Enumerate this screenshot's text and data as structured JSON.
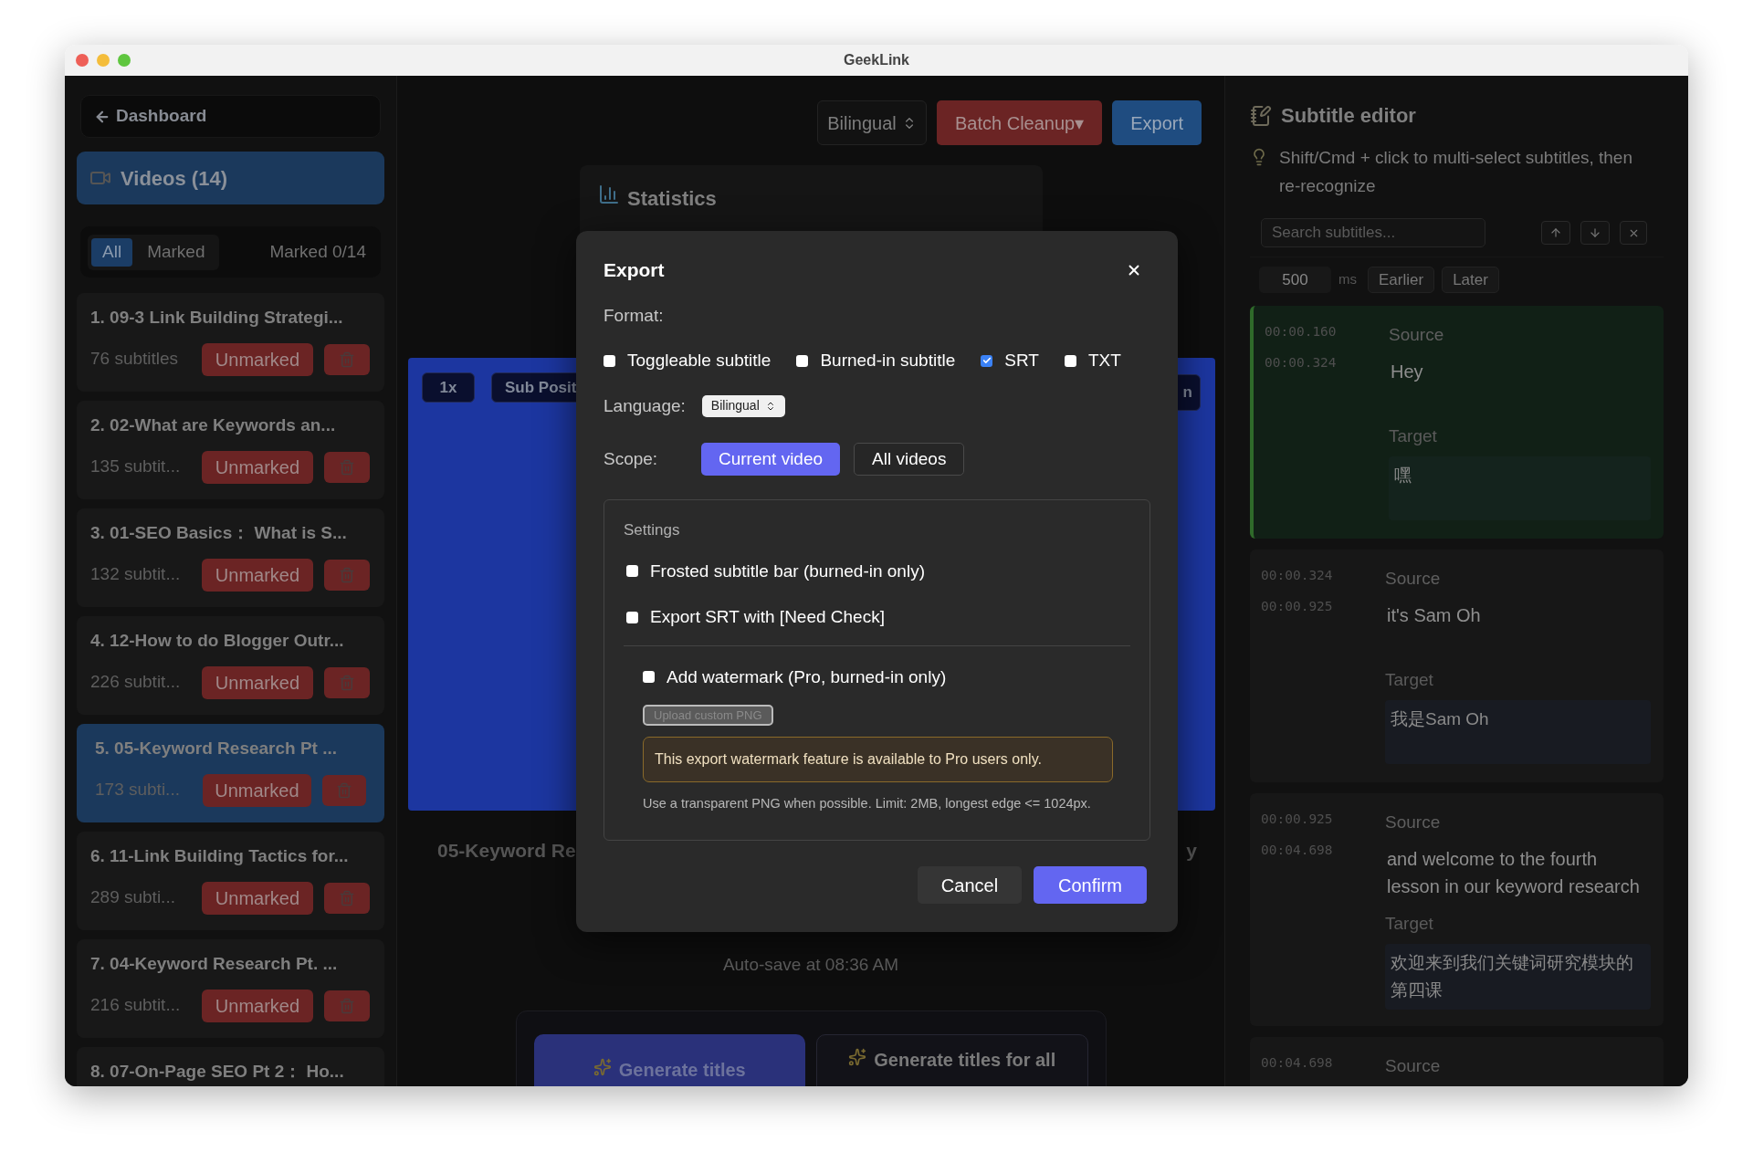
{
  "window": {
    "title": "GeekLink"
  },
  "sidebar": {
    "back_button": "Dashboard",
    "videos_header": "Videos (14)",
    "filters": [
      {
        "label": "All",
        "selected": true
      },
      {
        "label": "Marked",
        "selected": false
      }
    ],
    "marked_count": "Marked 0/14",
    "videos": [
      {
        "title": "1. 09-3 Link Building Strategi...",
        "count": "76 subtitles",
        "status": "Unmarked",
        "selected": false
      },
      {
        "title": "2. 02-What are Keywords an...",
        "count": "135 subtit...",
        "status": "Unmarked",
        "selected": false
      },
      {
        "title": "3. 01-SEO Basics：  What is S...",
        "count": "132 subtit...",
        "status": "Unmarked",
        "selected": false
      },
      {
        "title": "4. 12-How to do Blogger Outr...",
        "count": "226 subtit...",
        "status": "Unmarked",
        "selected": false
      },
      {
        "title": "5. 05-Keyword Research Pt ...",
        "count": "173 subti...",
        "status": "Unmarked",
        "selected": true
      },
      {
        "title": "6. 11-Link Building Tactics for...",
        "count": "289 subti...",
        "status": "Unmarked",
        "selected": false
      },
      {
        "title": "7. 04-Keyword Research Pt. ...",
        "count": "216 subtit...",
        "status": "Unmarked",
        "selected": false
      },
      {
        "title": "8. 07-On-Page SEO Pt 2：  Ho...",
        "selected": false
      }
    ]
  },
  "toolbar": {
    "language_select": "Bilingual",
    "buttons": [
      {
        "label": "Batch Cleanup▾",
        "kind": "danger"
      },
      {
        "label": "Export",
        "kind": "primary"
      }
    ]
  },
  "statistics": {
    "title": "Statistics"
  },
  "player": {
    "controls": [
      "1x",
      "Sub Posit",
      "n"
    ],
    "title_left": "05-Keyword Re",
    "title_right": "y"
  },
  "autosave": "Auto-save at 08:36 AM",
  "title_actions": [
    {
      "label": "Generate titles",
      "kind": "primary"
    },
    {
      "label": "Generate titles for all",
      "kind": "secondary"
    }
  ],
  "subtitle_editor": {
    "title": "Subtitle editor",
    "hint": "Shift/Cmd + click to multi-select subtitles, then re-recognize",
    "search": {
      "placeholder": "Search subtitles..."
    },
    "offset": {
      "value": "500",
      "unit": "ms"
    },
    "shift_buttons": [
      "Earlier",
      "Later"
    ],
    "subtitles": [
      {
        "start": "00:00.160",
        "end": "00:00.324",
        "source_label": "Source",
        "source": "Hey",
        "target_label": "Target",
        "target": "嘿",
        "selected": true
      },
      {
        "start": "00:00.324",
        "end": "00:00.925",
        "source_label": "Source",
        "source": "it's Sam Oh",
        "target_label": "Target",
        "target": "我是Sam Oh",
        "selected": false
      },
      {
        "start": "00:00.925",
        "end": "00:04.698",
        "source_label": "Source",
        "source": "and welcome to the fourth lesson in our keyword research",
        "target_label": "Target",
        "target": "欢迎来到我们关键词研究模块的第四课",
        "selected": false
      },
      {
        "start": "00:04.698",
        "source_label": "Source",
        "selected": false
      }
    ]
  },
  "dialog": {
    "title": "Export",
    "format_label": "Format:",
    "formats": [
      {
        "label": "Toggleable subtitle",
        "checked": false
      },
      {
        "label": "Burned-in subtitle",
        "checked": false
      },
      {
        "label": "SRT",
        "checked": true
      },
      {
        "label": "TXT",
        "checked": false
      }
    ],
    "language_label": "Language:",
    "language": "Bilingual",
    "scope_label": "Scope:",
    "scopes": [
      {
        "label": "Current video",
        "selected": true
      },
      {
        "label": "All videos",
        "selected": false
      }
    ],
    "settings": {
      "legend": "Settings",
      "options": [
        {
          "label": "Frosted subtitle bar (burned-in only)",
          "checked": false
        },
        {
          "label": "Export SRT with [Need Check]",
          "checked": false
        }
      ],
      "watermark": {
        "label": "Add watermark (Pro, burned-in only)",
        "checked": false
      },
      "upload_button": {
        "label": "Upload custom PNG",
        "disabled": true
      },
      "notice": "This export watermark feature is available to Pro users only.",
      "help": "Use a transparent PNG when possible. Limit: 2MB, longest edge <= 1024px."
    },
    "buttons": [
      {
        "label": "Cancel",
        "kind": "secondary"
      },
      {
        "label": "Confirm",
        "kind": "primary"
      }
    ]
  }
}
